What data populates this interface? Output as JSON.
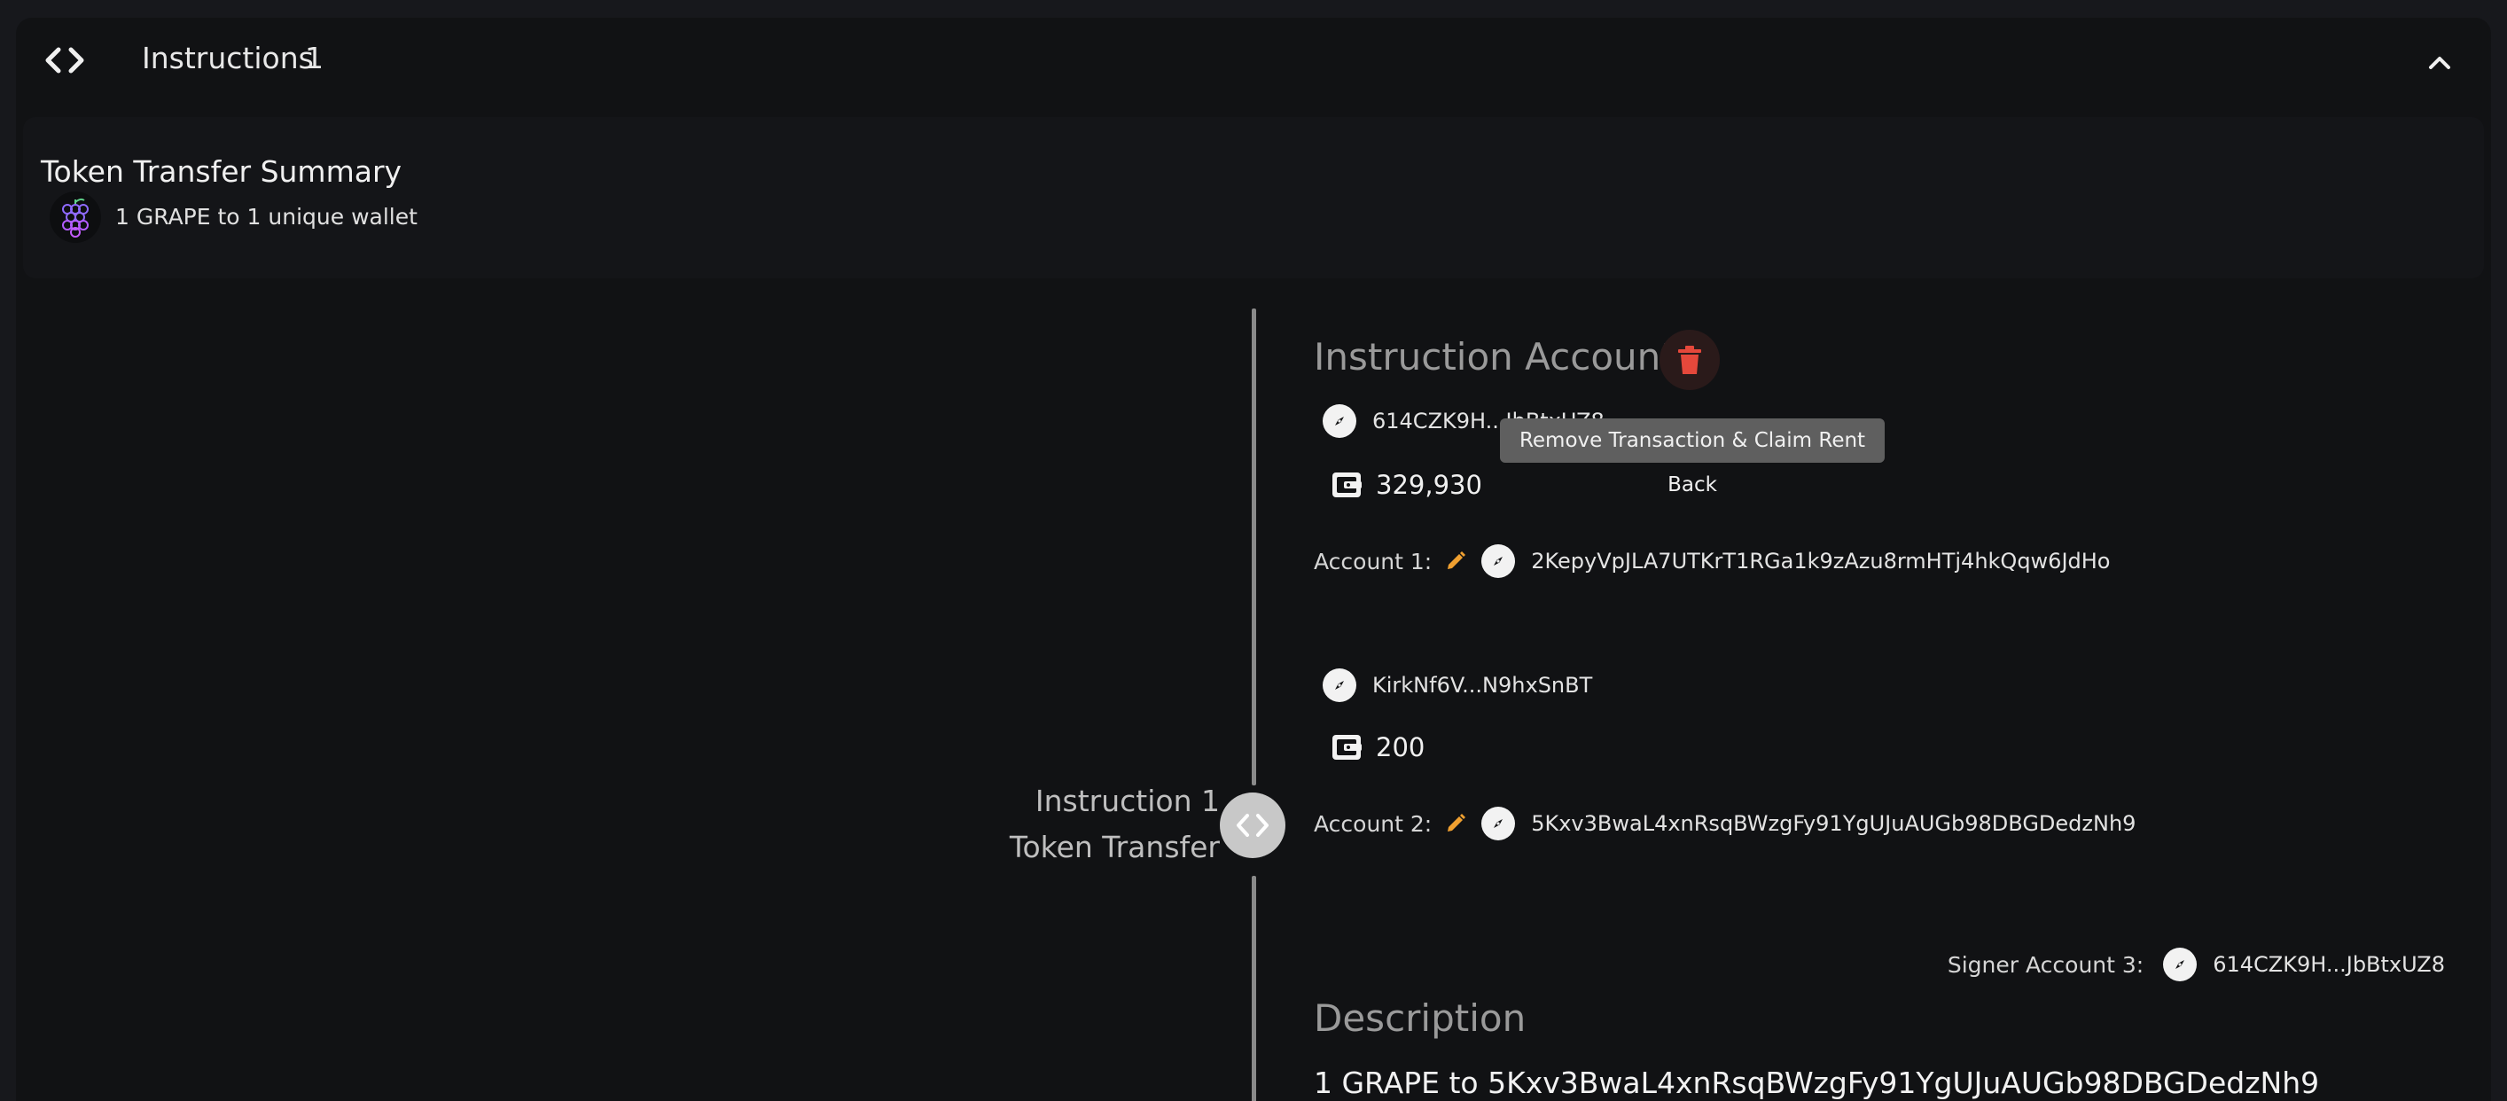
{
  "header": {
    "title": "Instructions",
    "count": "1"
  },
  "summary": {
    "title": "Token Transfer Summary",
    "line": "1 GRAPE to 1 unique wallet",
    "token_icon": "grape-icon"
  },
  "instruction": {
    "index_label": "Instruction 1",
    "type_label": "Token Transfer"
  },
  "accounts_section": {
    "title": "Instruction Accounts",
    "delete_tooltip": "Remove Transaction & Claim Rent Back",
    "accounts": [
      {
        "owner_short": "614CZK9H...JbBtxUZ8",
        "balance": "329,930",
        "label": "Account 1:",
        "address": "2KepyVpJLA7UTKrT1RGa1k9zAzu8rmHTj4hkQqw6JdHo"
      },
      {
        "owner_short": "KirkNf6V...N9hxSnBT",
        "balance": "200",
        "label": "Account 2:",
        "address": "5Kxv3BwaL4xnRsqBWzgFy91YgUJuAUGb98DBGDedzNh9"
      }
    ],
    "signer": {
      "label": "Signer Account 3:",
      "address": "614CZK9H...JbBtxUZ8"
    }
  },
  "description": {
    "title": "Description",
    "text": "1 GRAPE to 5Kxv3BwaL4xnRsqBWzgFy91YgUJuAUGb98DBGDedzNh9"
  },
  "colors": {
    "background": "#111214",
    "accent_pencil": "#f0a030",
    "delete_red": "#e5483b",
    "timeline": "#8a8a8a"
  }
}
